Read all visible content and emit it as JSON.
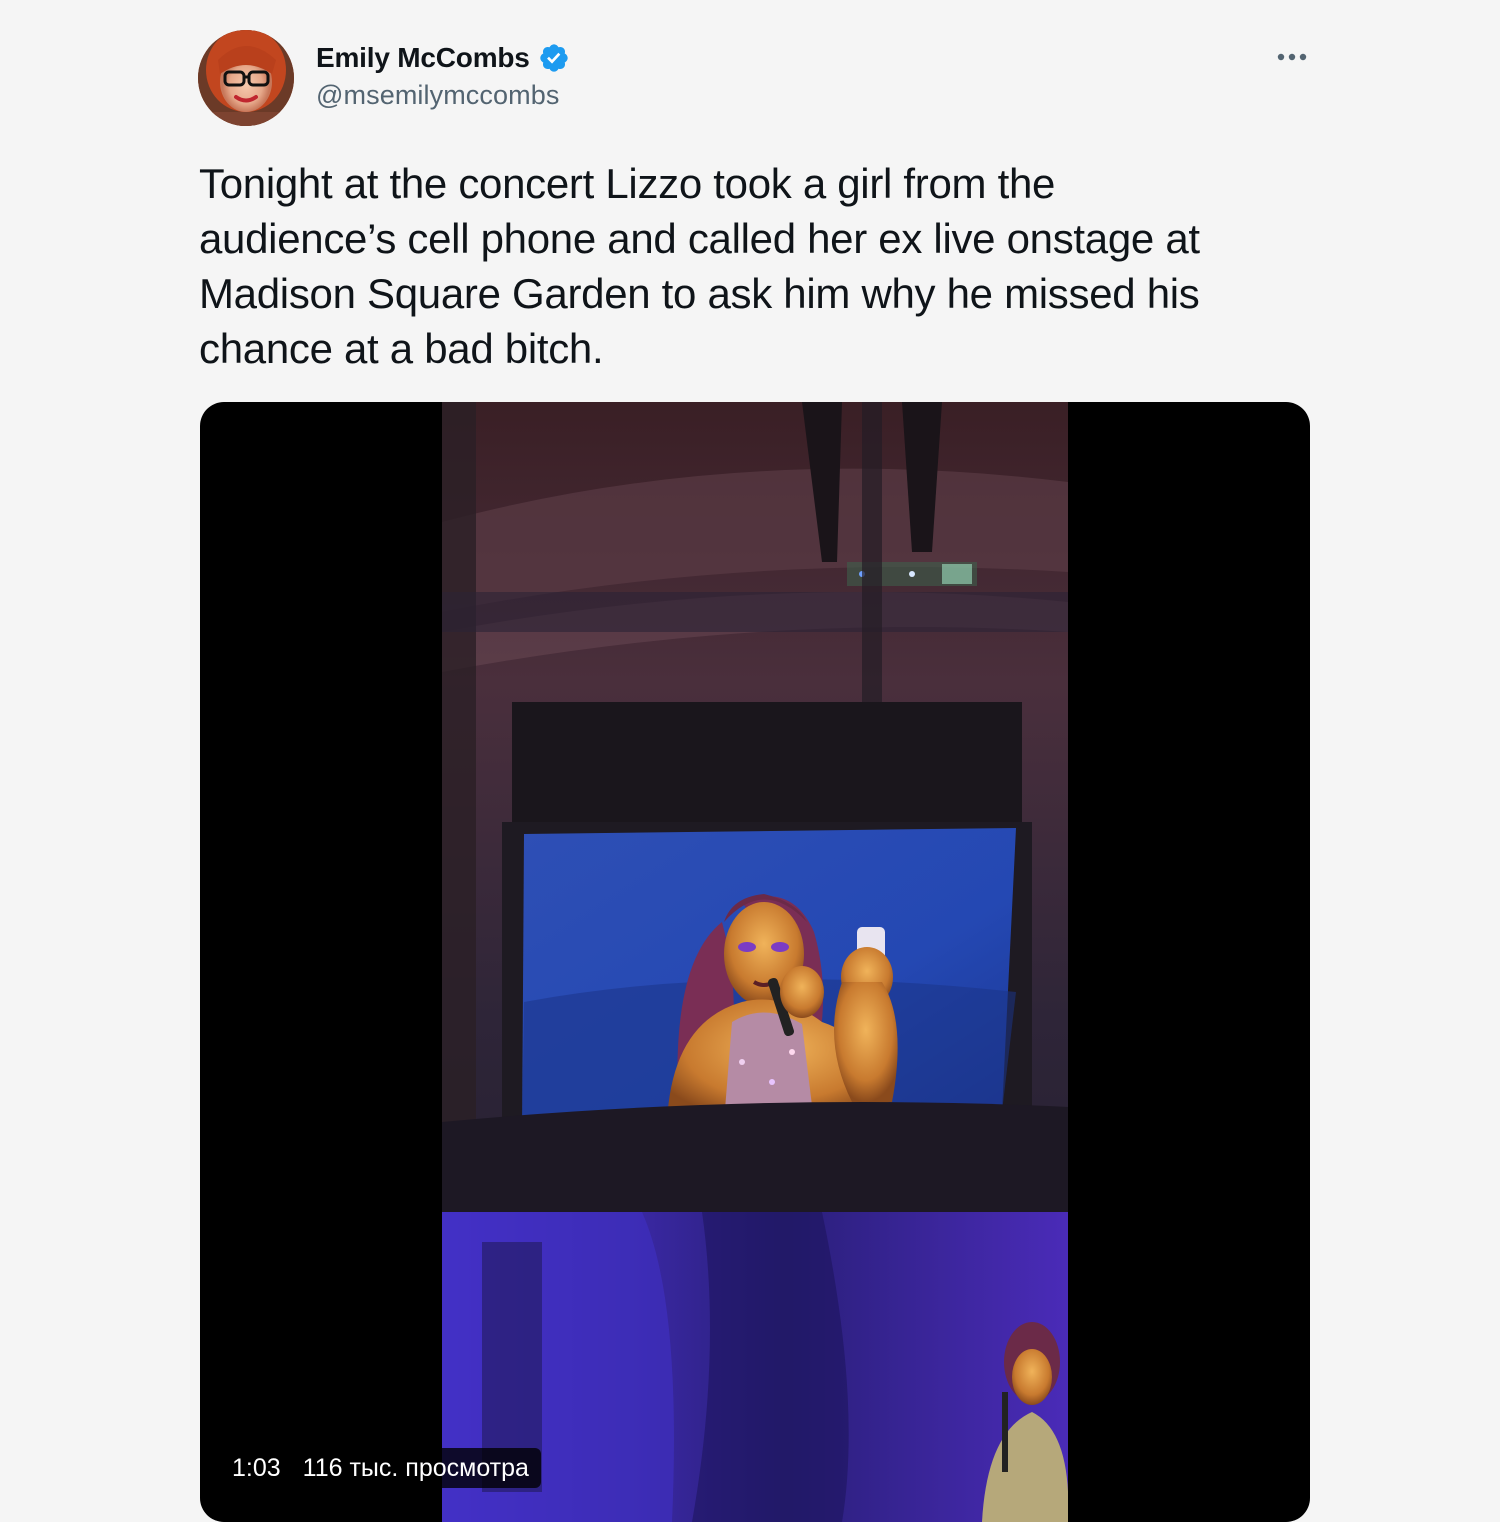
{
  "author": {
    "display_name": "Emily McCombs",
    "handle": "@msemilymccombs",
    "verified": true,
    "avatar_icon": "profile-photo"
  },
  "actions": {
    "more_icon": "more-horizontal-icon"
  },
  "tweet": {
    "text": "Tonight at the concert Lizzo took a girl from the\naudience’s cell phone and called her ex live onstage at\nMadison Square Garden to ask him why he missed his\nchance at a bad bitch."
  },
  "media": {
    "type": "video",
    "duration": "1:03",
    "views": "116 тыс. просмотра"
  },
  "colors": {
    "background": "#f5f5f5",
    "text_primary": "#0f1419",
    "text_secondary": "#536471",
    "verified_blue": "#1d9bf0",
    "media_background": "#000000"
  }
}
